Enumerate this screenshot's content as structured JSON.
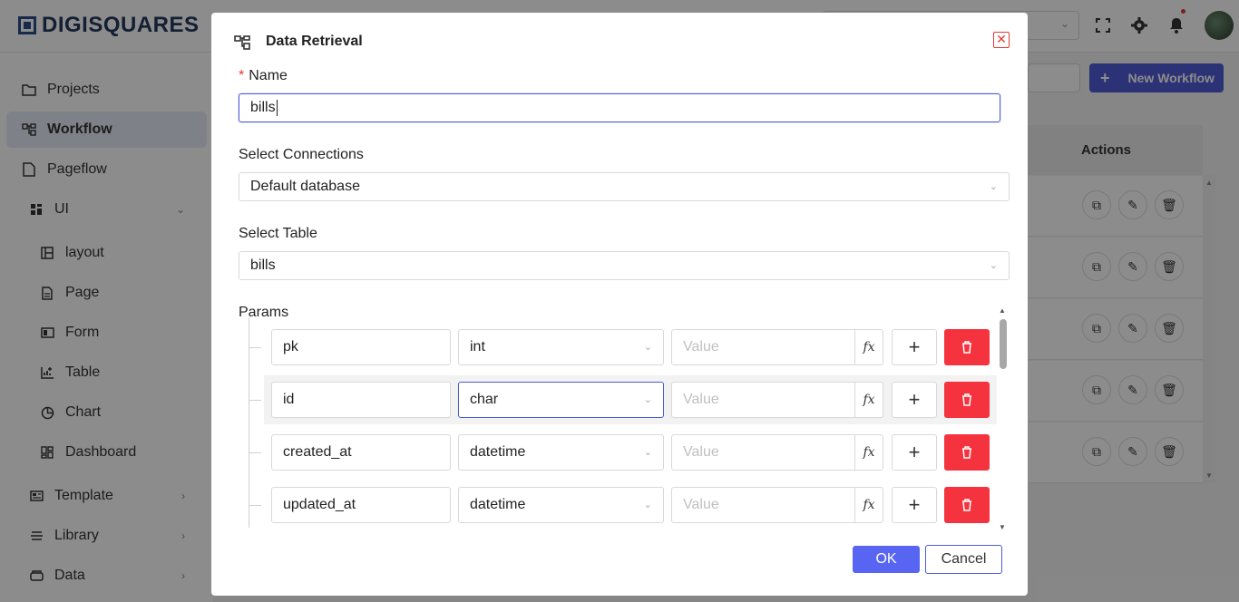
{
  "app": {
    "brand": "DIGISQUARES"
  },
  "sidebar": {
    "items": [
      {
        "label": "Projects",
        "icon": "folder-icon"
      },
      {
        "label": "Workflow",
        "icon": "workflow-icon"
      },
      {
        "label": "Pageflow",
        "icon": "pageflow-icon"
      },
      {
        "label": "UI",
        "icon": "ui-icon"
      },
      {
        "label": "layout",
        "icon": "layout-icon"
      },
      {
        "label": "Page",
        "icon": "page-icon"
      },
      {
        "label": "Form",
        "icon": "form-icon"
      },
      {
        "label": "Table",
        "icon": "table-icon"
      },
      {
        "label": "Chart",
        "icon": "chart-icon"
      },
      {
        "label": "Dashboard",
        "icon": "dashboard-icon"
      },
      {
        "label": "Template",
        "icon": "template-icon"
      },
      {
        "label": "Library",
        "icon": "library-icon"
      },
      {
        "label": "Data",
        "icon": "data-icon"
      }
    ]
  },
  "main": {
    "new_workflow_label": "New Workflow",
    "actions_header": "Actions"
  },
  "modal": {
    "title": "Data Retrieval",
    "name_label": "Name",
    "name_value": "bills",
    "connections_label": "Select Connections",
    "connections_value": "Default database",
    "table_label": "Select Table",
    "table_value": "bills",
    "params_label": "Params",
    "value_placeholder": "Value",
    "fx_label": "fx",
    "ok_label": "OK",
    "cancel_label": "Cancel",
    "params": [
      {
        "name": "pk",
        "type": "int"
      },
      {
        "name": "id",
        "type": "char"
      },
      {
        "name": "created_at",
        "type": "datetime"
      },
      {
        "name": "updated_at",
        "type": "datetime"
      }
    ]
  },
  "colors": {
    "accent": "#4f5bd5",
    "danger": "#f5333f"
  }
}
